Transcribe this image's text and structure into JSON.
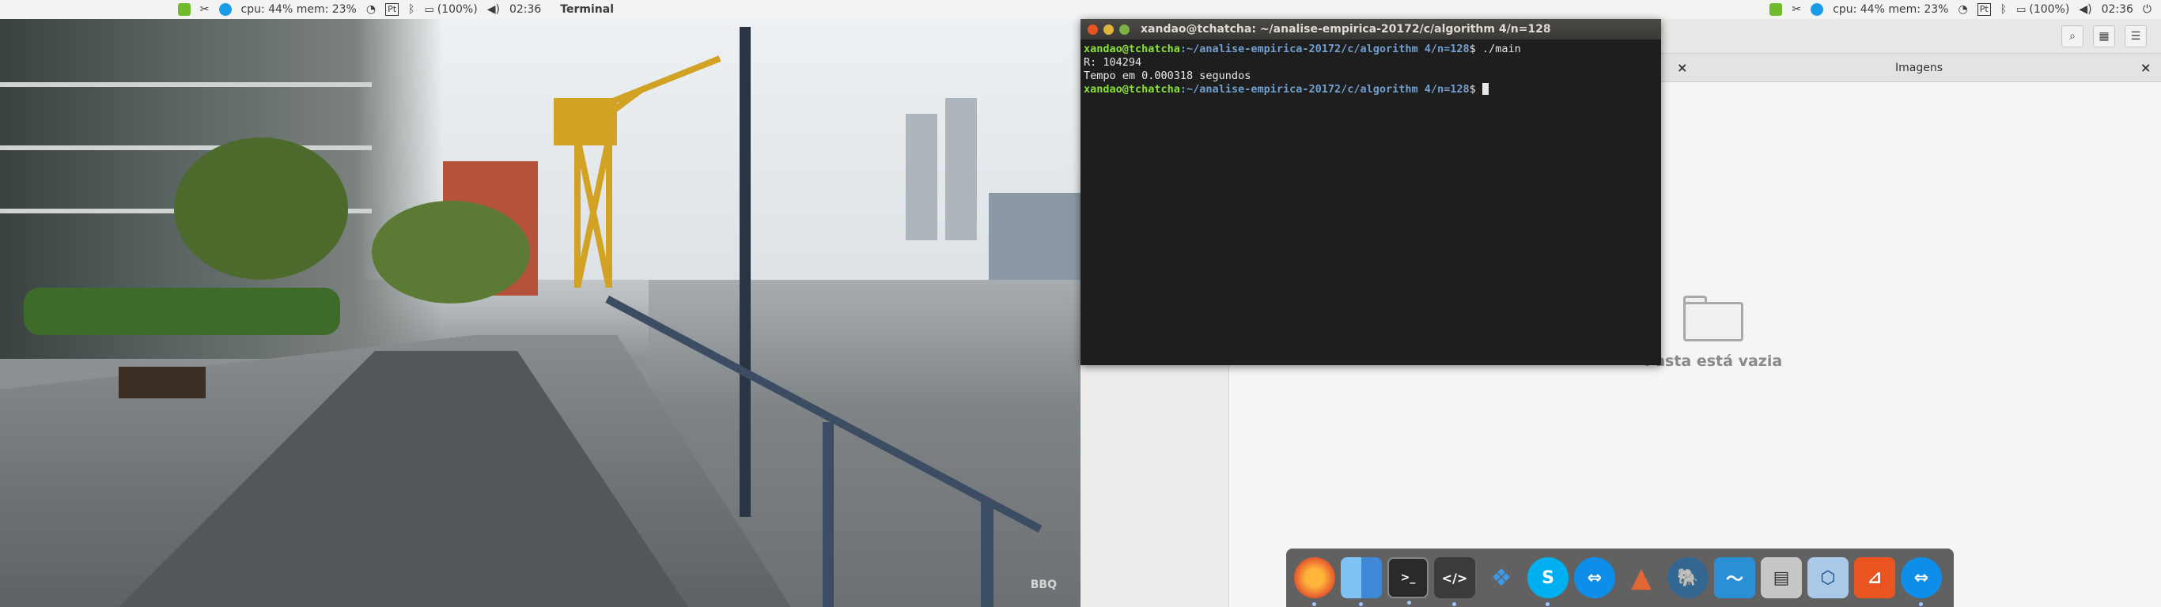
{
  "topbar_left": {
    "sysmon": "cpu: 44% mem: 23%",
    "keyboard": "Pt",
    "battery": "(100%)",
    "clock": "02:36",
    "active_app": "Terminal"
  },
  "topbar_right": {
    "sysmon": "cpu: 44% mem: 23%",
    "keyboard": "Pt",
    "battery": "(100%)",
    "clock": "02:36"
  },
  "video": {
    "watermark": "BBQ"
  },
  "terminal": {
    "title": "xandao@tchatcha: ~/analise-empirica-20172/c/algorithm 4/n=128",
    "prompt_user": "xandao@tchatcha",
    "prompt_path": ":~/analise-empirica-20172/c/algorithm 4/n=128",
    "prompt_symbol": "$",
    "command": " ./main",
    "output_line1": "R: 104294",
    "output_line2": "Tempo em 0.000318 segundos"
  },
  "files": {
    "tab_images": "Imagens",
    "empty_message": "Pasta está vazia"
  },
  "dock": {
    "items": [
      "firefox-icon",
      "finder-icon",
      "terminal-icon",
      "code-editor-icon",
      "dropbox-icon",
      "skype-icon",
      "teamviewer-icon",
      "matlab-icon",
      "postgresql-icon",
      "mysql-workbench-icon",
      "scanner-icon",
      "virtualbox-icon",
      "ubuntu-software-icon",
      "teamviewer-2-icon"
    ]
  }
}
